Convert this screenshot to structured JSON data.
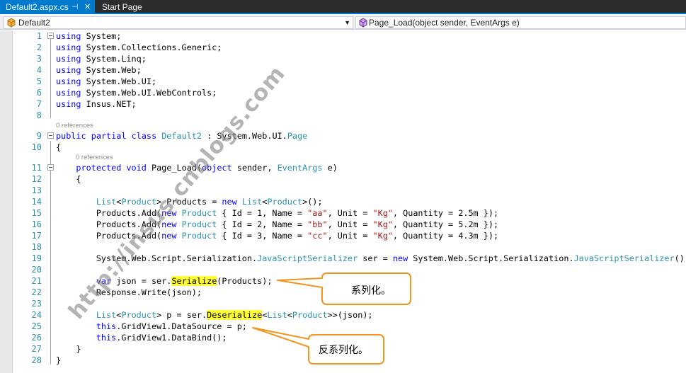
{
  "tabs": [
    {
      "label": "Default2.aspx.cs",
      "active": true,
      "pin_glyph": "⊣",
      "close_glyph": "✕"
    },
    {
      "label": "Start Page",
      "active": false
    }
  ],
  "navbar": {
    "class_selector": "Default2",
    "member_selector": "Page_Load(object sender, EventArgs e)"
  },
  "editor": {
    "references_label": "0 references",
    "line_numbers": [
      "1",
      "2",
      "3",
      "4",
      "5",
      "6",
      "7",
      "8",
      "9",
      "10",
      "11",
      "12",
      "13",
      "14",
      "15",
      "16",
      "17",
      "18",
      "19",
      "20",
      "21",
      "22",
      "23",
      "24",
      "25",
      "26",
      "27",
      "28"
    ]
  },
  "watermark": "http://insus.cnblogs.com",
  "callouts": {
    "serialize": "系列化。",
    "deserialize": "反系列化。"
  },
  "colors": {
    "keyword": "#0000ff",
    "type": "#2b91af",
    "string": "#a31515",
    "highlight": "#ffff33",
    "callout_border": "#f0961e",
    "accent": "#007acc"
  },
  "icons": [
    "pin-icon",
    "close-icon",
    "class-icon",
    "method-icon",
    "collapse-icon",
    "dropdown-arrow-icon"
  ]
}
